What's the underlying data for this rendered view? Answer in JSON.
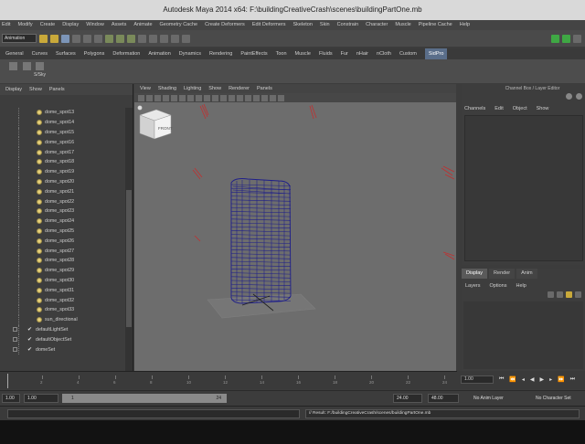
{
  "window": {
    "title": "Autodesk Maya 2014 x64: F:\\buildingCreativeCrash\\scenes\\buildingPartOne.mb"
  },
  "menubar": [
    "Edit",
    "Modify",
    "Create",
    "Display",
    "Window",
    "Assets",
    "Animate",
    "Geometry Cache",
    "Create Deformers",
    "Edit Deformers",
    "Skeleton",
    "Skin",
    "Constrain",
    "Character",
    "Muscle",
    "Pipeline Cache",
    "Help"
  ],
  "status_line": {
    "mode": "Animation"
  },
  "shelf": {
    "tabs": [
      "General",
      "Curves",
      "Surfaces",
      "Polygons",
      "Deformation",
      "Animation",
      "Dynamics",
      "Rendering",
      "PaintEffects",
      "Toon",
      "Muscle",
      "Fluids",
      "Fur",
      "nHair",
      "nCloth",
      "Custom",
      "SidPro"
    ],
    "active_tab": "SidPro",
    "items": [
      {
        "label": ""
      },
      {
        "label": ""
      },
      {
        "label": "S/Sky"
      }
    ]
  },
  "outliner": {
    "menu": [
      "Display",
      "Show",
      "Panels"
    ],
    "items": [
      {
        "label": "dome_spot13",
        "type": "light"
      },
      {
        "label": "dome_spot14",
        "type": "light"
      },
      {
        "label": "dome_spot15",
        "type": "light"
      },
      {
        "label": "dome_spot16",
        "type": "light"
      },
      {
        "label": "dome_spot17",
        "type": "light"
      },
      {
        "label": "dome_spot18",
        "type": "light"
      },
      {
        "label": "dome_spot19",
        "type": "light"
      },
      {
        "label": "dome_spot20",
        "type": "light"
      },
      {
        "label": "dome_spot21",
        "type": "light"
      },
      {
        "label": "dome_spot22",
        "type": "light"
      },
      {
        "label": "dome_spot23",
        "type": "light"
      },
      {
        "label": "dome_spot24",
        "type": "light"
      },
      {
        "label": "dome_spot25",
        "type": "light"
      },
      {
        "label": "dome_spot26",
        "type": "light"
      },
      {
        "label": "dome_spot27",
        "type": "light"
      },
      {
        "label": "dome_spot28",
        "type": "light"
      },
      {
        "label": "dome_spot29",
        "type": "light"
      },
      {
        "label": "dome_spot30",
        "type": "light"
      },
      {
        "label": "dome_spot31",
        "type": "light"
      },
      {
        "label": "dome_spot32",
        "type": "light"
      },
      {
        "label": "dome_spot33",
        "type": "light"
      },
      {
        "label": "sun_directional",
        "type": "light"
      },
      {
        "label": "defaultLightSet",
        "type": "set"
      },
      {
        "label": "defaultObjectSet",
        "type": "set"
      },
      {
        "label": "domeSet",
        "type": "set"
      }
    ]
  },
  "viewport": {
    "menu": [
      "View",
      "Shading",
      "Lighting",
      "Show",
      "Renderer",
      "Panels"
    ],
    "viewcube_label": "FRONT"
  },
  "channel_box": {
    "title": "Channel Box / Layer Editor",
    "menu": [
      "Channels",
      "Edit",
      "Object",
      "Show"
    ]
  },
  "layer_editor": {
    "tabs": [
      "Display",
      "Render",
      "Anim"
    ],
    "active_tab": "Display",
    "menu": [
      "Layers",
      "Options",
      "Help"
    ]
  },
  "time_slider": {
    "ticks": [
      "2",
      "4",
      "6",
      "8",
      "10",
      "12",
      "14",
      "16",
      "18",
      "20",
      "22",
      "24"
    ],
    "current_frame": "1.00"
  },
  "range_slider": {
    "start": "1.00",
    "playback_start": "1.00",
    "range_start": "1",
    "range_end": "24",
    "playback_end": "24.00",
    "end": "48.00",
    "anim_layer": "No Anim Layer",
    "character_set": "No Character Set"
  },
  "command_line": {
    "result": "// Result: F:/buildingCreativeCrash/scenes/buildingPartOne.mb"
  }
}
